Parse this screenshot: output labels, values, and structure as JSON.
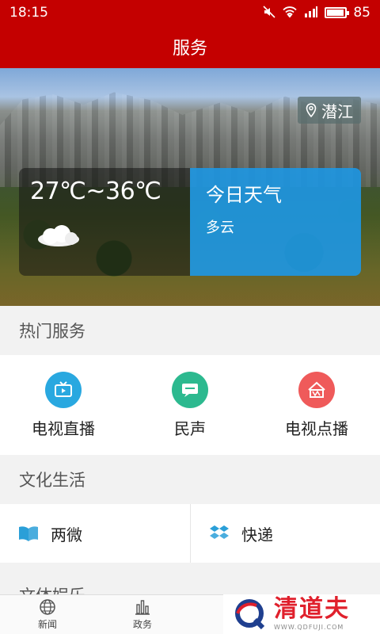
{
  "status_bar": {
    "time": "18:15",
    "battery": "85",
    "battery_level": 0.85
  },
  "header": {
    "title": "服务"
  },
  "hero": {
    "location": "潜江",
    "temperature": "27℃~36℃",
    "weather_title": "今日天气",
    "weather_desc": "多云"
  },
  "hot_services": {
    "title": "热门服务",
    "items": [
      {
        "label": "电视直播",
        "icon": "tv-icon",
        "color": "#29a8e0"
      },
      {
        "label": "民声",
        "icon": "chat-icon",
        "color": "#2cb98f"
      },
      {
        "label": "电视点播",
        "icon": "vod-icon",
        "color": "#ef5a5a"
      }
    ]
  },
  "culture": {
    "title": "文化生活",
    "items": [
      {
        "label": "两微",
        "icon": "book-icon",
        "color": "#2a9fd8"
      },
      {
        "label": "快递",
        "icon": "box-icon",
        "color": "#2a9fd8"
      }
    ]
  },
  "next_section": {
    "title": "文体娱乐"
  },
  "bottom_nav": {
    "items": [
      {
        "label": "新闻",
        "icon": "globe-icon"
      },
      {
        "label": "政务",
        "icon": "bar-chart-icon"
      }
    ]
  },
  "watermark": {
    "cn": "清道夫",
    "en": "WWW.QDFUJI.COM"
  },
  "colors": {
    "brand_red": "#c40000",
    "weather_blue": "#1e96e1"
  }
}
